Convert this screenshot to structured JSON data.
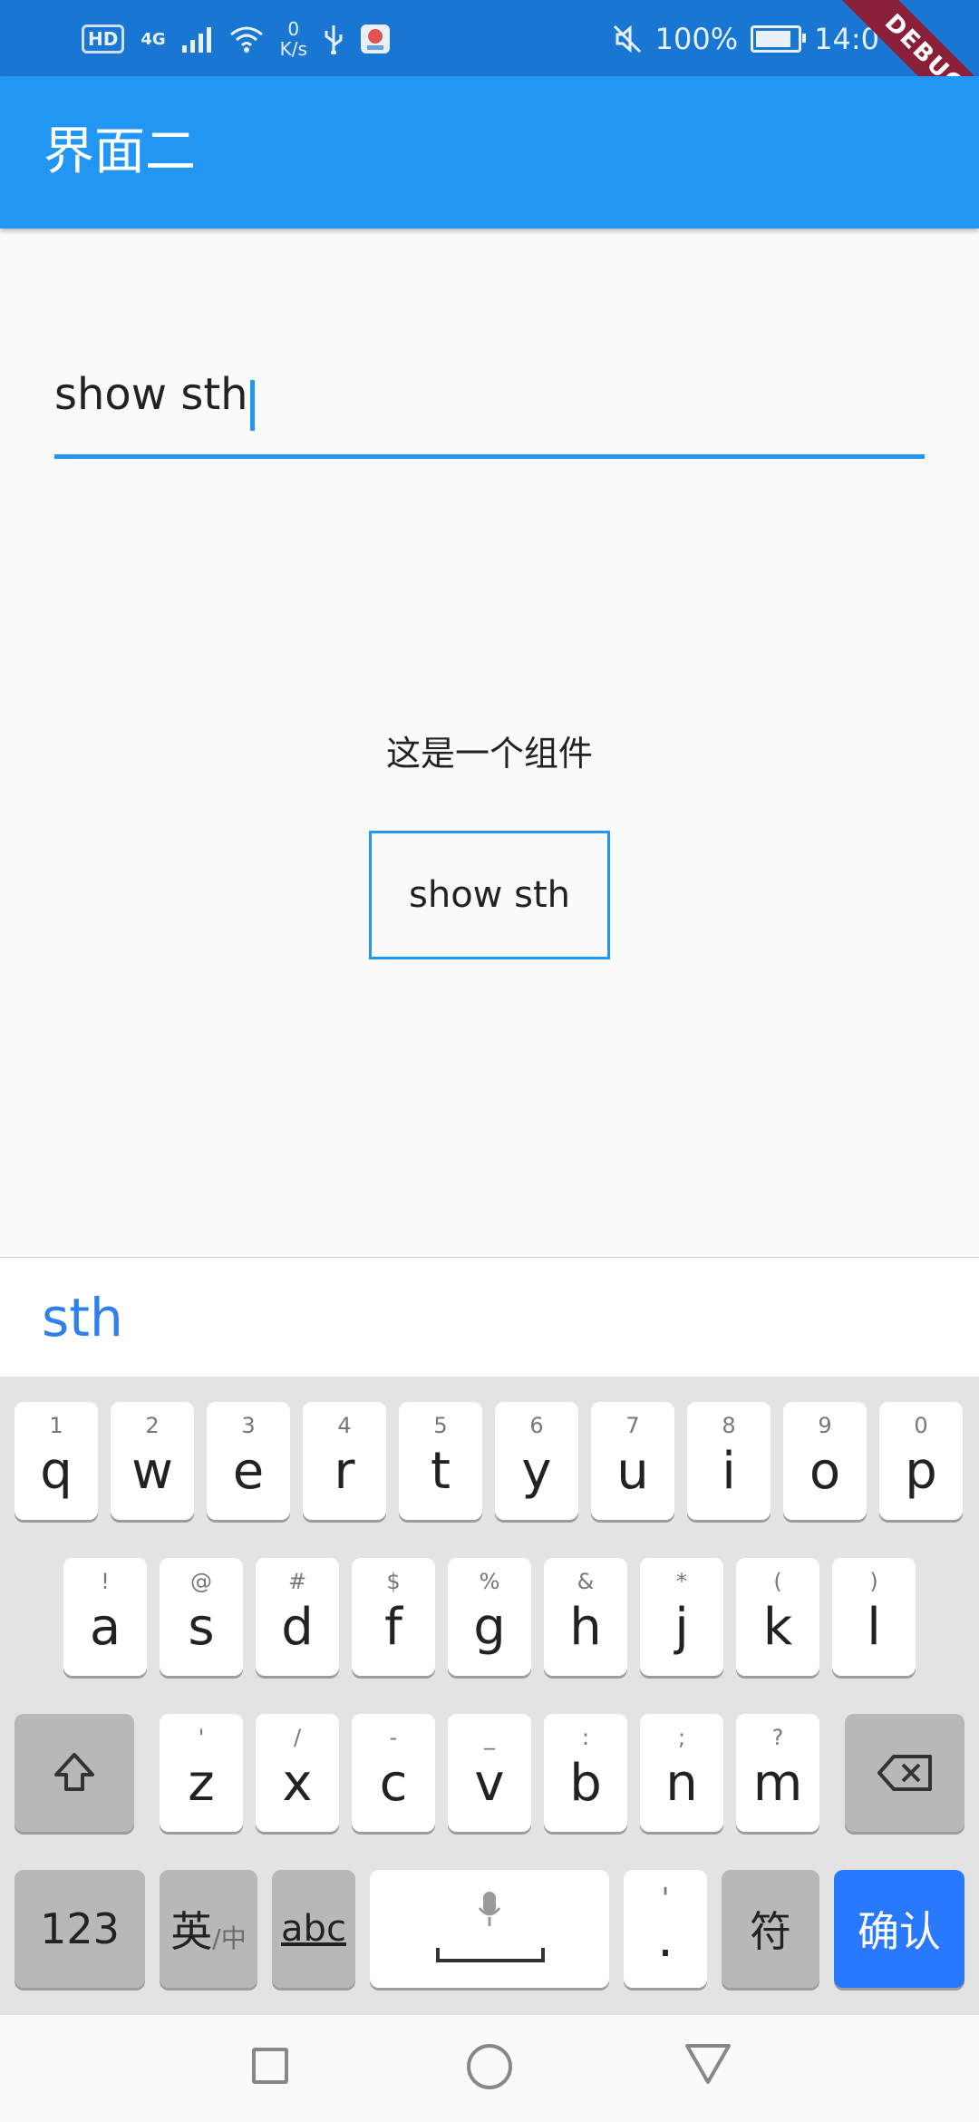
{
  "status_bar": {
    "hd": "HD",
    "network": "4G",
    "speed_value": "0",
    "speed_unit": "K/s",
    "battery": "100%",
    "time": "14:0"
  },
  "debug_banner": "DEBUG",
  "app_bar": {
    "title": "界面二"
  },
  "text_field": {
    "value": "show sth"
  },
  "widget_label": "这是一个组件",
  "show_button_label": "show sth",
  "suggestion": "sth",
  "keyboard": {
    "row1": [
      {
        "main": "q",
        "sub": "1"
      },
      {
        "main": "w",
        "sub": "2"
      },
      {
        "main": "e",
        "sub": "3"
      },
      {
        "main": "r",
        "sub": "4"
      },
      {
        "main": "t",
        "sub": "5"
      },
      {
        "main": "y",
        "sub": "6"
      },
      {
        "main": "u",
        "sub": "7"
      },
      {
        "main": "i",
        "sub": "8"
      },
      {
        "main": "o",
        "sub": "9"
      },
      {
        "main": "p",
        "sub": "0"
      }
    ],
    "row2": [
      {
        "main": "a",
        "sub": "!"
      },
      {
        "main": "s",
        "sub": "@"
      },
      {
        "main": "d",
        "sub": "#"
      },
      {
        "main": "f",
        "sub": "$"
      },
      {
        "main": "g",
        "sub": "%"
      },
      {
        "main": "h",
        "sub": "&"
      },
      {
        "main": "j",
        "sub": "*"
      },
      {
        "main": "k",
        "sub": "("
      },
      {
        "main": "l",
        "sub": ")"
      }
    ],
    "row3": [
      {
        "main": "z",
        "sub": "'"
      },
      {
        "main": "x",
        "sub": "/"
      },
      {
        "main": "c",
        "sub": "-"
      },
      {
        "main": "v",
        "sub": "_"
      },
      {
        "main": "b",
        "sub": ":"
      },
      {
        "main": "n",
        "sub": ";"
      },
      {
        "main": "m",
        "sub": "?"
      }
    ],
    "shift_icon": "shift-icon",
    "backspace_icon": "backspace-icon",
    "numbers_label": "123",
    "lang_label": "英",
    "lang_sub": "/中",
    "abc_label": "abc",
    "mic_icon": "microphone-icon",
    "comma_label": "'",
    "period_label": ".",
    "symbols_label": "符",
    "confirm_label": "确认"
  },
  "colors": {
    "primary": "#2196f3",
    "status_bar": "#1976d2",
    "confirm_key": "#2979ff",
    "suggestion_text": "#2f80ed",
    "debug_banner": "#8a1f3a"
  }
}
